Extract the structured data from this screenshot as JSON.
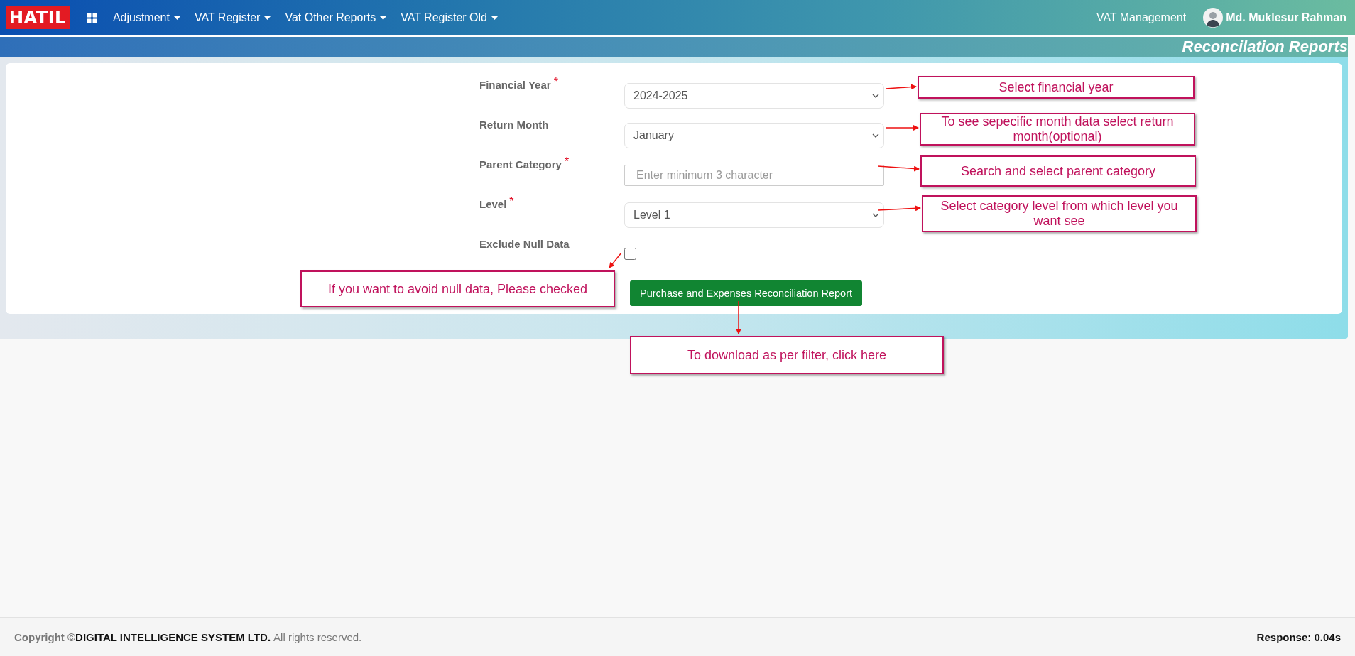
{
  "navbar": {
    "logo": "HATIL",
    "menus": [
      {
        "label": "Adjustment"
      },
      {
        "label": "VAT Register"
      },
      {
        "label": "Vat Other Reports"
      },
      {
        "label": "VAT Register Old"
      }
    ],
    "app_name": "VAT Management",
    "user": "Md. Muklesur Rahman"
  },
  "page_title": "Reconcilation Reports",
  "form": {
    "fields": [
      {
        "kind": "select",
        "label": "Financial Year",
        "required_mark": "*",
        "value": "2024-2025"
      },
      {
        "kind": "select",
        "label": "Return Month",
        "value": "January"
      },
      {
        "kind": "search",
        "label": "Parent Category",
        "required_mark": "*",
        "placeholder": "Enter minimum 3 character"
      },
      {
        "kind": "select",
        "label": "Level",
        "required_mark": "*",
        "value": "Level 1"
      },
      {
        "kind": "checkbox",
        "label": "Exclude Null Data",
        "checked": false
      }
    ],
    "submit_button": "Purchase and Expenses Reconciliation Report"
  },
  "annotations": [
    {
      "text": "Select financial year"
    },
    {
      "text": "To see sepecific month data select return month(optional)"
    },
    {
      "text": "Search and select parent category"
    },
    {
      "text": "Select category level from which level you want see"
    },
    {
      "text": "If you want to avoid null data, Please checked"
    },
    {
      "text": "To download as per filter, click here"
    }
  ],
  "footer": {
    "copyright": "Copyright ©",
    "company": "DIGITAL INTELLIGENCE SYSTEM LTD.",
    "rights": "All rights reserved.",
    "response": "Response: 0.04s"
  }
}
